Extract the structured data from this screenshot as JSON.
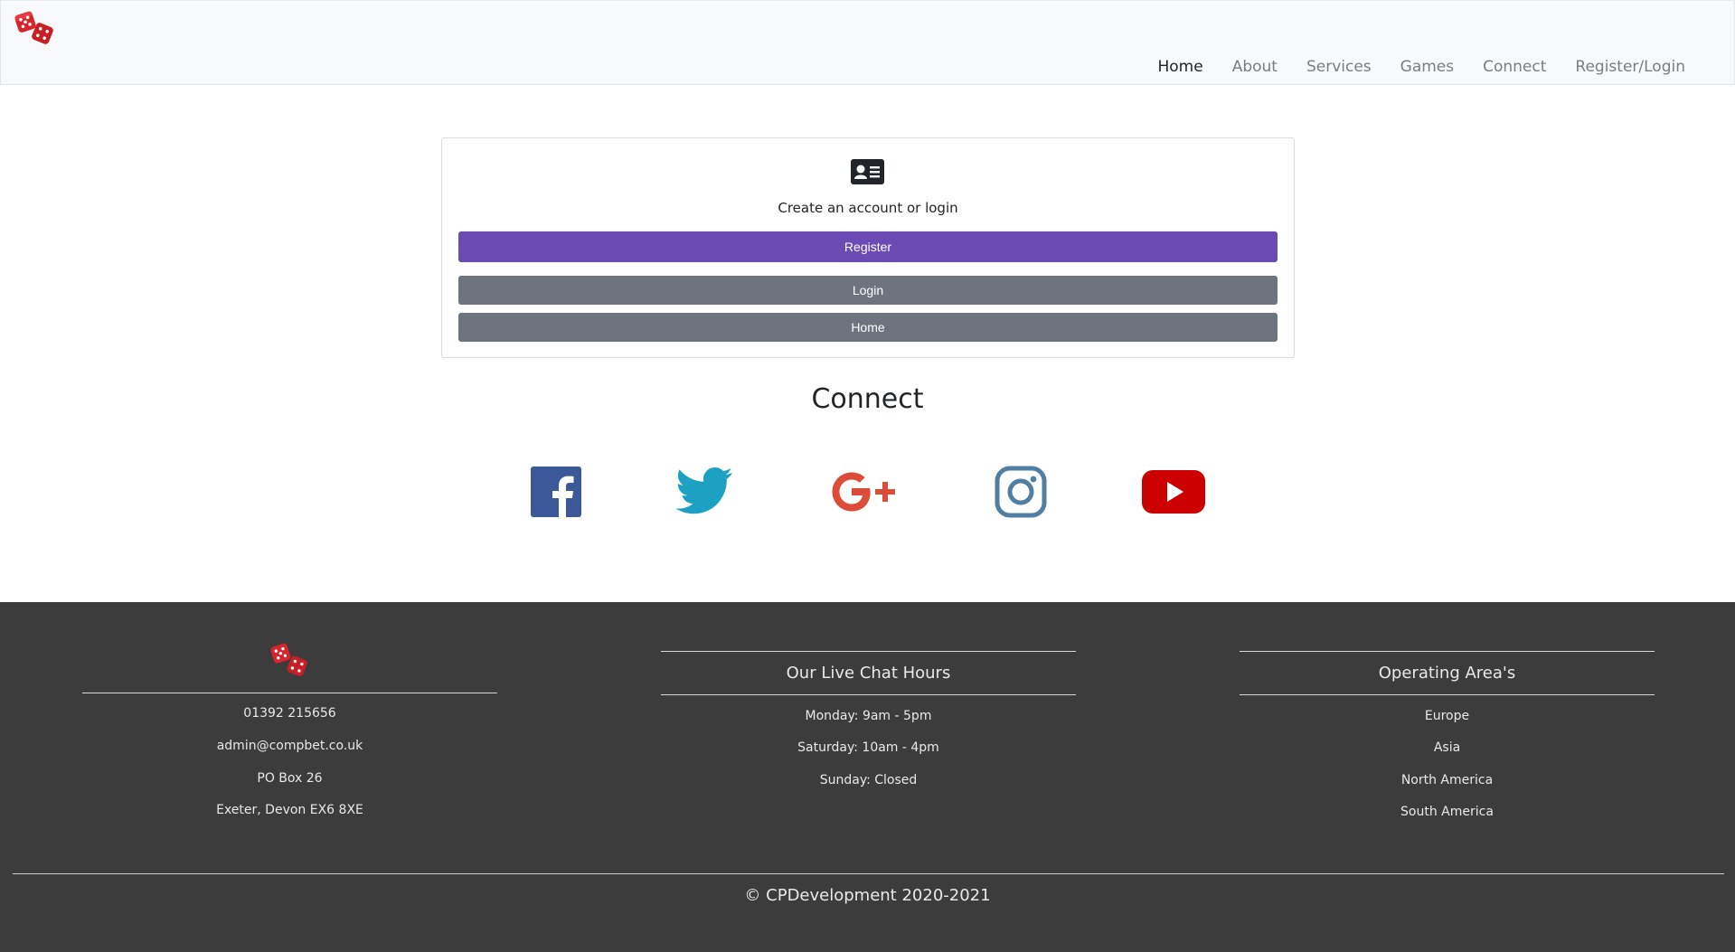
{
  "navbar": {
    "brand_icon": "dice-icon",
    "links": [
      {
        "label": "Home",
        "active": true
      },
      {
        "label": "About"
      },
      {
        "label": "Services"
      },
      {
        "label": "Games"
      },
      {
        "label": "Connect"
      },
      {
        "label": "Register/Login"
      }
    ]
  },
  "auth_card": {
    "icon": "id-card-icon",
    "text": "Create an account or login",
    "register_label": "Register",
    "login_label": "Login",
    "home_label": "Home"
  },
  "connect": {
    "title": "Connect",
    "icons": [
      "facebook-icon",
      "twitter-icon",
      "google-plus-icon",
      "instagram-icon",
      "youtube-icon"
    ]
  },
  "footer": {
    "contact": {
      "logo": "dice-icon",
      "lines": [
        "01392 215656",
        "admin@compbet.co.uk",
        "PO Box 26",
        "Exeter, Devon EX6 8XE"
      ]
    },
    "chat_hours": {
      "title": "Our Live Chat Hours",
      "lines": [
        "Monday: 9am - 5pm",
        "Saturday: 10am - 4pm",
        "Sunday: Closed"
      ]
    },
    "operating_areas": {
      "title": "Operating Area's",
      "lines": [
        "Europe",
        "Asia",
        "North America",
        "South America"
      ]
    },
    "copyright": "© CPDevelopment 2020-2021"
  },
  "colors": {
    "register_button": "#6a4bb3",
    "secondary_button": "#6c757d",
    "footer_bg": "#3c3c3c",
    "facebook": "#3b5998",
    "twitter": "#1da1c2",
    "google_plus": "#dd4b39",
    "instagram": "#517fa4",
    "youtube": "#cc0000"
  }
}
